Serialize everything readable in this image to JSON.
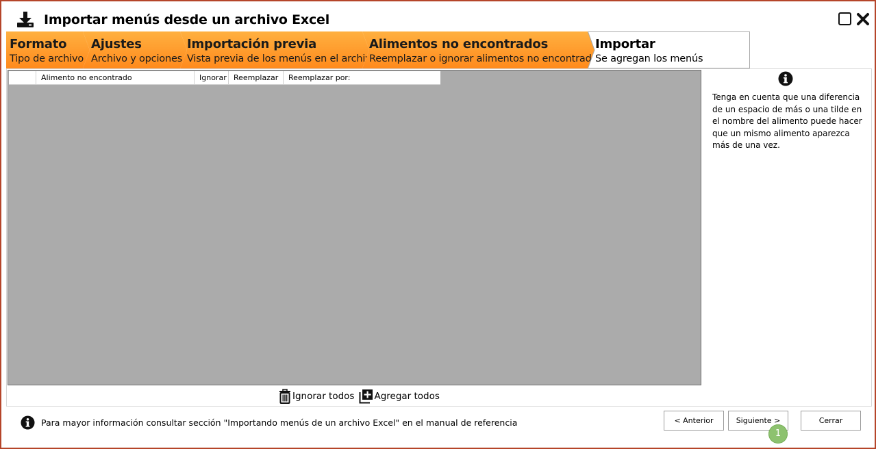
{
  "window": {
    "title": "Importar menús desde un archivo Excel",
    "accent_color": "#b5452a"
  },
  "steps": [
    {
      "title": "Formato",
      "subtitle": "Tipo de archivo",
      "state": "done"
    },
    {
      "title": "Ajustes",
      "subtitle": "Archivo y opciones",
      "state": "done"
    },
    {
      "title": "Importación previa",
      "subtitle": "Vista previa de los menús en el archivo",
      "state": "done"
    },
    {
      "title": "Alimentos no encontrados",
      "subtitle": "Reemplazar o ignorar alimentos no encontrados",
      "state": "active"
    },
    {
      "title": "Importar",
      "subtitle": "Se agregan los menús",
      "state": "pending"
    }
  ],
  "step_colors": {
    "orange_top": "#ffb347",
    "orange_bottom": "#ff8c1a",
    "pending": "#ffffff"
  },
  "grid": {
    "columns": [
      "",
      "Alimento no encontrado",
      "Ignorar",
      "Reemplazar",
      "Reemplazar por:"
    ],
    "rows": [],
    "background": "#ababab"
  },
  "info_panel": {
    "icon": "info-icon",
    "text": "Tenga en cuenta que una diferencia de un espacio de más o una tilde en el nombre del alimento puede hacer que un mismo  alimento aparezca más de una vez."
  },
  "grid_actions": {
    "ignore_all": "Ignorar todos",
    "add_all": "Agregar todos"
  },
  "footer": {
    "info_text": "Para mayor información consultar  sección \"Importando menús de un archivo Excel\" en el manual de referencia",
    "prev_label": "< Anterior",
    "next_label": "Siguiente >",
    "close_label": "Cerrar",
    "badge": "1"
  }
}
